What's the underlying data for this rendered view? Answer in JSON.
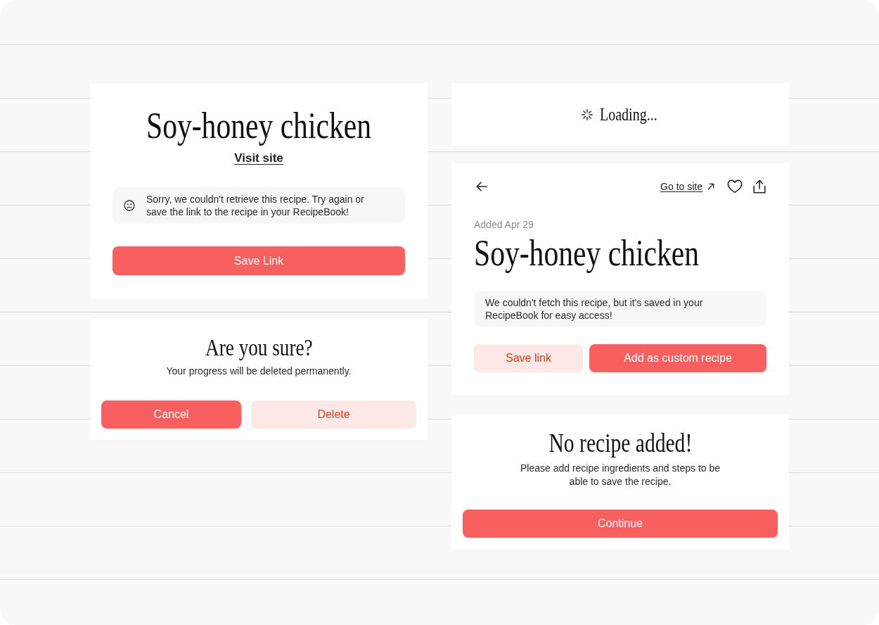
{
  "recipe_error_card": {
    "title": "Soy-honey chicken",
    "link": "Visit site",
    "message": "Sorry, we couldn't retrieve this recipe. Try again or save the link to the recipe in your RecipeBook!",
    "buttons": [
      {
        "label": "Save Link",
        "kind": "primary"
      }
    ]
  },
  "confirm_dialog": {
    "title": "Are you sure?",
    "message": "Your progress will be deleted permanently.",
    "buttons": [
      {
        "label": "Cancel",
        "kind": "primary"
      },
      {
        "label": "Delete",
        "kind": "secondary"
      }
    ]
  },
  "loading_card": {
    "label": "Loading..."
  },
  "recipe_detail_card": {
    "link": "Go to site",
    "added": "Added Apr 29",
    "title": "Soy-honey chicken",
    "message": "We couldn't fetch this recipe, but it's saved in your RecipeBook for easy access!",
    "buttons": [
      {
        "label": "Save link",
        "kind": "secondary"
      },
      {
        "label": "Add as custom recipe",
        "kind": "primary"
      }
    ]
  },
  "empty_recipe_dialog": {
    "title": "No recipe added!",
    "message": "Please add recipe ingredients and steps to be able to save the recipe.",
    "buttons": [
      {
        "label": "Continue",
        "kind": "primary"
      }
    ]
  }
}
